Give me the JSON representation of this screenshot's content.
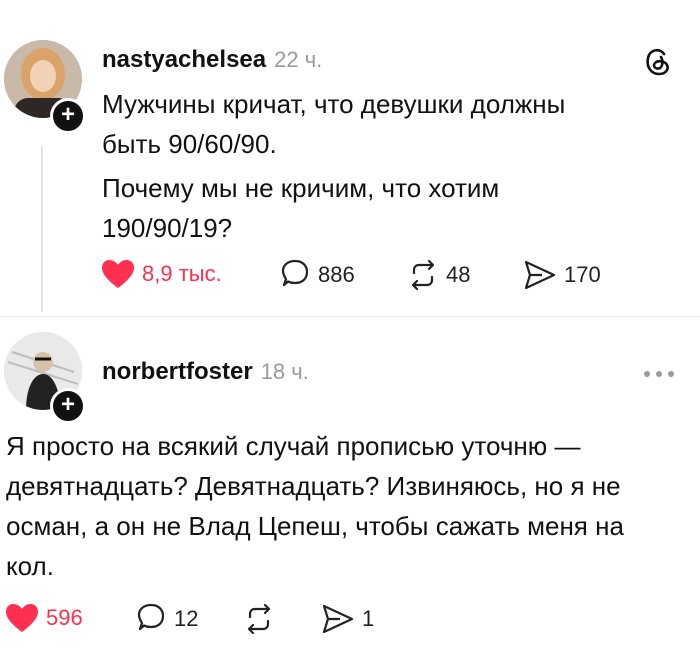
{
  "posts": [
    {
      "username": "nastyachelsea",
      "time": "22 ч.",
      "text_lines": [
        "Мужчины кричат, что девушки должны",
        "быть 90/60/90.",
        "Почему мы не кричим, что хотим",
        "190/90/19?"
      ],
      "likes": "8,9 тыс.",
      "comments": "886",
      "reposts": "48",
      "shares": "170"
    },
    {
      "username": "norbertfoster",
      "time": "18 ч.",
      "text_lines": [
        "Я просто на всякий случай прописью уточню —",
        "девятнадцать? Девятнадцать? Извиняюсь, но я не",
        "осман, а он не Влад Цепеш, чтобы сажать меня на",
        "кол."
      ],
      "likes": "596",
      "comments": "12",
      "reposts": "",
      "shares": "1"
    }
  ],
  "colors": {
    "like": "#ff2f4f",
    "text": "#111111",
    "muted": "#9a9a9a"
  },
  "icons": [
    "threads-logo-icon",
    "heart-icon",
    "comment-icon",
    "repost-icon",
    "share-icon",
    "more-icon",
    "follow-plus-icon"
  ]
}
